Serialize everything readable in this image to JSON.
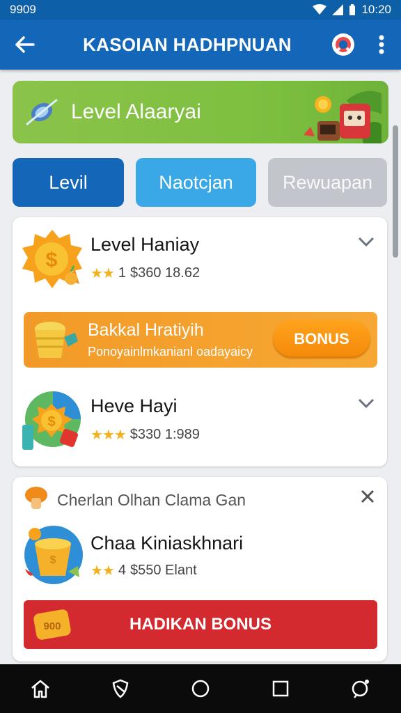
{
  "status": {
    "left_text": "9909",
    "time": "10:20"
  },
  "appbar": {
    "title": "KASOIAN HADHPNUAN"
  },
  "banner": {
    "title": "Level Alaaryai"
  },
  "tabs": [
    {
      "label": "Levil"
    },
    {
      "label": "Naotcjan"
    },
    {
      "label": "Rewuapan"
    }
  ],
  "card1": {
    "item1": {
      "title": "Level Haniay",
      "stars": "★★",
      "count": "1",
      "sub": "$360 18.62"
    },
    "promo": {
      "title": "Bakkal Hratiyih",
      "subtitle": "Ponoyainlmkanianl oadayaicy",
      "button": "BONUS"
    },
    "item2": {
      "title": "Heve Hayi",
      "stars": "★★★",
      "sub": "$330 1:989"
    }
  },
  "card2": {
    "header": "Cherlan Olhan Clama Gan",
    "item": {
      "title": "Chaa Kiniaskhnari",
      "stars": "★★",
      "count": "4",
      "sub": "$550 Elant"
    },
    "button": {
      "label": "HADIKAN BONUS",
      "coin_text": "900"
    }
  },
  "colors": {
    "primary": "#1467b8",
    "accent": "#3aa7e6",
    "banner": "#8bc34a",
    "promo": "#f29a28",
    "danger": "#d22a2e"
  }
}
